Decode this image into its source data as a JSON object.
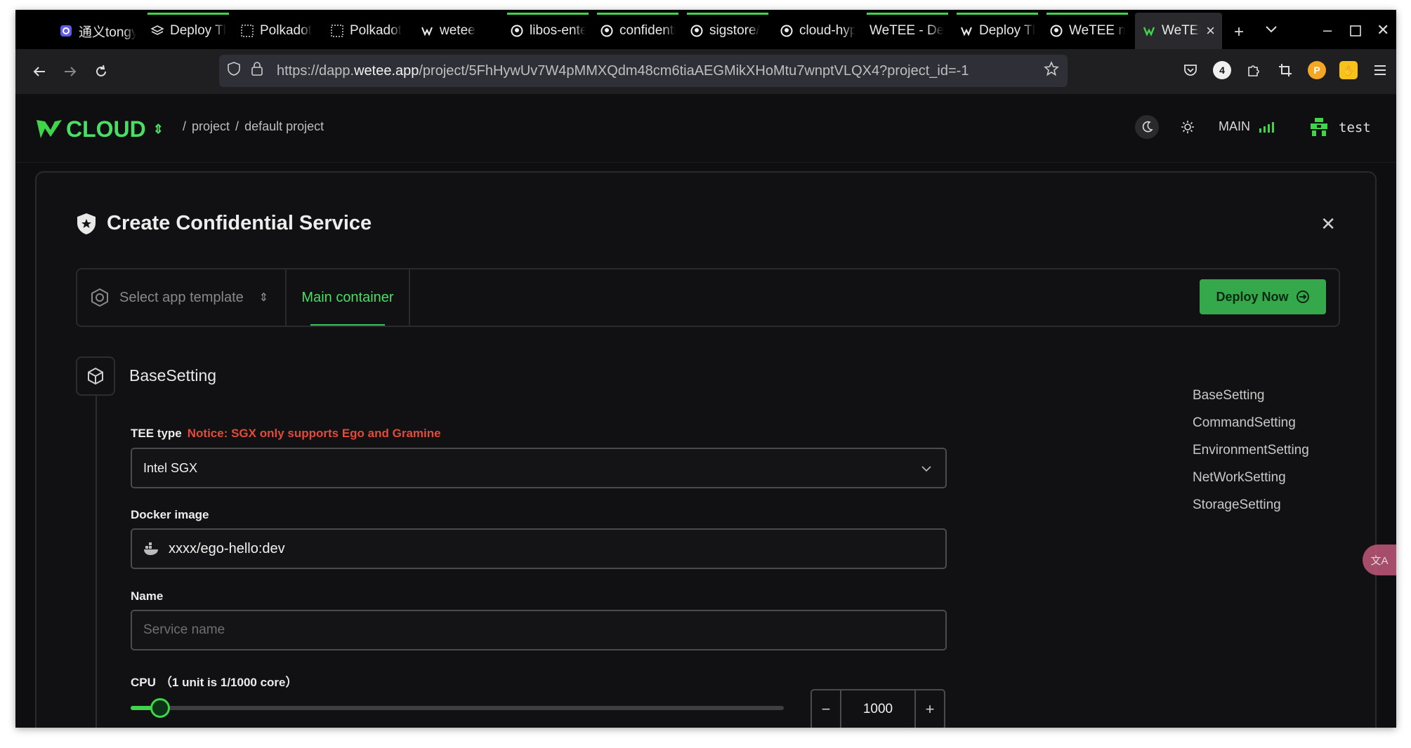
{
  "browser": {
    "tabs": [
      {
        "label": "通义tongyi",
        "icon": "tongyi-icon",
        "loading": false
      },
      {
        "label": "Deploy The",
        "icon": "layers-icon",
        "loading": true
      },
      {
        "label": "Polkadot",
        "icon": "polkadot-icon",
        "loading": false
      },
      {
        "label": "Polkadot",
        "icon": "polkadot-icon",
        "loading": false
      },
      {
        "label": "wetee",
        "icon": "wetee-icon",
        "loading": false
      },
      {
        "label": "libos-enter",
        "icon": "github-icon",
        "loading": true
      },
      {
        "label": "confidential",
        "icon": "github-icon",
        "loading": true
      },
      {
        "label": "sigstore/",
        "icon": "github-icon",
        "loading": true
      },
      {
        "label": "cloud-hyp",
        "icon": "github-icon",
        "loading": false
      },
      {
        "label": "WeTEE - De",
        "icon": "",
        "loading": true
      },
      {
        "label": "Deploy The",
        "icon": "wetee-icon",
        "loading": true
      },
      {
        "label": "WeTEE n",
        "icon": "github-icon",
        "loading": true
      },
      {
        "label": "WeTEE",
        "icon": "wetee-icon",
        "loading": false,
        "active": true
      }
    ],
    "url_prefix": "https://dapp.",
    "url_host": "wetee.app",
    "url_path": "/project/5FhHywUv7W4pMMXQdm48cm6tiaAEGMikXHoMtu7wnptVLQX4?project_id=-1",
    "badge_count": "4"
  },
  "header": {
    "logo_text": "CLOUD",
    "breadcrumb_sep": "/",
    "breadcrumb_1": "project",
    "breadcrumb_2": "default project",
    "network": "MAIN",
    "user": "test"
  },
  "dialog": {
    "title": "Create Confidential Service",
    "template_placeholder": "Select app template",
    "main_tab": "Main container",
    "deploy_label": "Deploy Now",
    "section_title": "BaseSetting",
    "tee_label": "TEE type",
    "tee_notice": "Notice: SGX only supports Ego and Gramine",
    "tee_value": "Intel SGX",
    "docker_label": "Docker image",
    "docker_value": "xxxx/ego-hello:dev",
    "name_label": "Name",
    "name_placeholder": "Service name",
    "cpu_label": "CPU",
    "cpu_hint": "（1 unit is 1/1000 core）",
    "cpu_value": "1000",
    "cpu_fraction": 0.03
  },
  "toc": [
    "BaseSetting",
    "CommandSetting",
    "EnvironmentSetting",
    "NetWorkSetting",
    "StorageSetting"
  ],
  "colors": {
    "accent": "#3fd44a",
    "notice": "#e24a3b",
    "deploy": "#34a84a"
  }
}
